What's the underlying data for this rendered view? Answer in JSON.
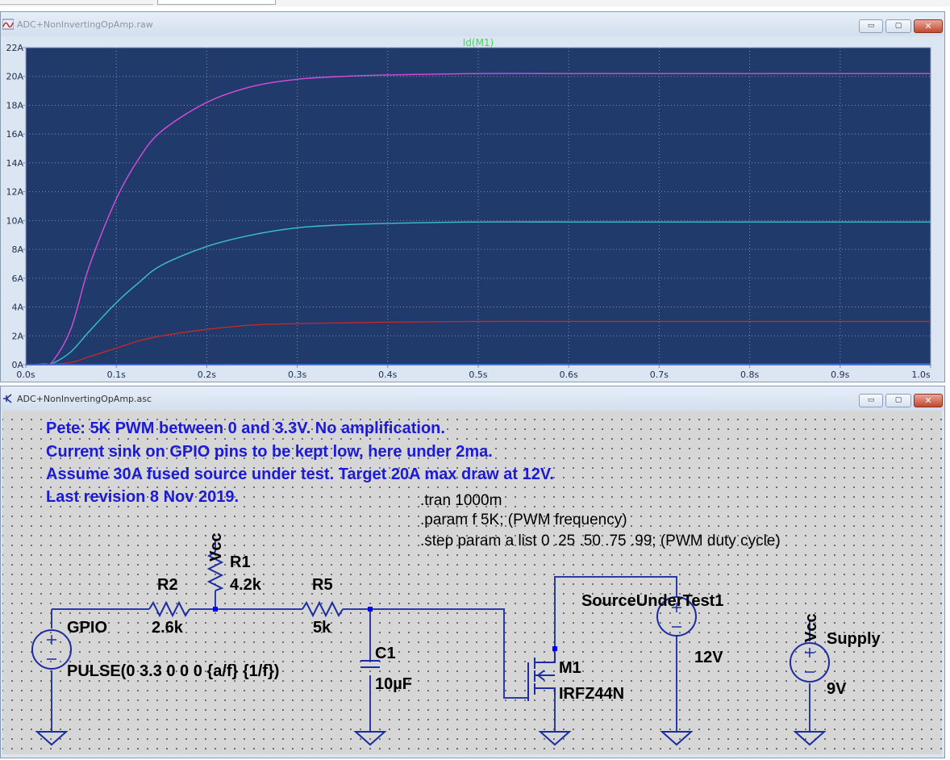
{
  "background": {
    "tab_hint": "ADC+NonInvertingOpAmp.asc"
  },
  "waveform_window": {
    "title": "ADC+NonInvertingOpAmp.raw",
    "controls": {
      "minimize": "▭",
      "restore": "▢",
      "close": "✕"
    },
    "trace_label": "Id(M1)",
    "plot_bg": "#213a6c",
    "grid_color": "#7f8fb0",
    "axis_text_color": "#a9b8d4"
  },
  "schematic_window": {
    "title": "ADC+NonInvertingOpAmp.asc",
    "controls": {
      "minimize": "▭",
      "restore": "▢",
      "close": "✕"
    },
    "notes": [
      "Pete:    5K  PWM between 0 and 3.3V.  No amplification.",
      "Current sink on GPIO pins to be kept low, here under 2ma.",
      "Assume 30A fused source under test.  Target 20A max draw at 12V.",
      "Last revision 8 Nov 2019."
    ],
    "directives": [
      ".tran 1000m",
      ".param f 5K;  (PWM frequency)",
      ".step param a list  0 .25 .50 .75 .99;  (PWM duty cycle)"
    ],
    "components": {
      "gpio": {
        "name": "GPIO",
        "value": "PULSE(0 3.3 0 0 0 {a/f} {1/f})"
      },
      "r2": {
        "name": "R2",
        "value": "2.6k"
      },
      "r1": {
        "name": "R1",
        "value": "4.2k"
      },
      "r5": {
        "name": "R5",
        "value": "5k"
      },
      "c1": {
        "name": "C1",
        "value": "10µF"
      },
      "m1": {
        "name": "M1",
        "value": "IRFZ44N"
      },
      "source": {
        "name": "SourceUnderTest1",
        "value": "12V"
      },
      "supply": {
        "name": "Supply",
        "value": "9V"
      },
      "vcc_r1": "Vcc",
      "vcc_supply": "Vcc"
    },
    "colors": {
      "note": "#1a1ad8",
      "wire": "#2a3aa8",
      "component": "#1d2ca0",
      "node": "#0000ff"
    }
  },
  "chart_data": {
    "type": "line",
    "title": "Id(M1)",
    "xlabel": "",
    "ylabel": "",
    "x_tick_labels": [
      "0.0s",
      "0.1s",
      "0.2s",
      "0.3s",
      "0.4s",
      "0.5s",
      "0.6s",
      "0.7s",
      "0.8s",
      "0.9s",
      "1.0s"
    ],
    "y_tick_labels": [
      "0A",
      "2A",
      "4A",
      "6A",
      "8A",
      "10A",
      "12A",
      "14A",
      "16A",
      "18A",
      "20A",
      "22A"
    ],
    "xlim": [
      0,
      1.0
    ],
    "ylim": [
      0,
      22
    ],
    "grid": true,
    "series": [
      {
        "color": "#d94cd9",
        "x": [
          0,
          0.02,
          0.03,
          0.05,
          0.07,
          0.1,
          0.125,
          0.15,
          0.2,
          0.25,
          0.3,
          0.35,
          0.4,
          0.5,
          0.6,
          0.7,
          0.8,
          0.9,
          1.0
        ],
        "y": [
          0,
          0.05,
          0.25,
          2.5,
          6.8,
          11.5,
          14.3,
          16.2,
          18.2,
          19.3,
          19.8,
          20.0,
          20.1,
          20.2,
          20.2,
          20.2,
          20.2,
          20.2,
          20.2
        ]
      },
      {
        "color": "#3ec0c8",
        "x": [
          0,
          0.02,
          0.03,
          0.05,
          0.07,
          0.1,
          0.125,
          0.15,
          0.2,
          0.25,
          0.3,
          0.35,
          0.4,
          0.5,
          0.6,
          0.7,
          0.8,
          0.9,
          1.0
        ],
        "y": [
          0,
          0.02,
          0.1,
          0.9,
          2.3,
          4.3,
          5.7,
          6.9,
          8.2,
          9.0,
          9.5,
          9.7,
          9.8,
          9.9,
          9.9,
          9.9,
          9.9,
          9.9,
          9.9
        ]
      },
      {
        "color": "#c42828",
        "x": [
          0,
          0.02,
          0.05,
          0.07,
          0.1,
          0.125,
          0.15,
          0.2,
          0.25,
          0.3,
          0.35,
          0.4,
          0.5,
          0.6,
          0.7,
          0.8,
          0.9,
          1.0
        ],
        "y": [
          0,
          0.01,
          0.15,
          0.55,
          1.15,
          1.65,
          2.0,
          2.45,
          2.75,
          2.85,
          2.9,
          2.95,
          3.0,
          3.0,
          3.0,
          3.0,
          3.0,
          3.0
        ]
      },
      {
        "color": "#6cdc7c",
        "x": [
          0,
          0.19,
          1.0
        ],
        "y": [
          0,
          0.01,
          0.03
        ]
      },
      {
        "color": "#3050e0",
        "x": [
          0,
          1.0
        ],
        "y": [
          0,
          0
        ]
      }
    ]
  }
}
